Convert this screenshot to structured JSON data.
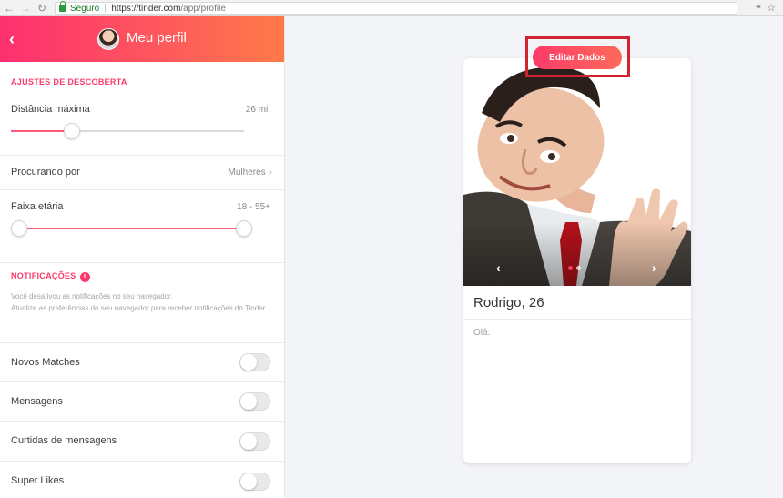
{
  "browser": {
    "secure_label": "Seguro",
    "url_host": "https://tinder.com",
    "url_path": "/app/profile"
  },
  "sidebar": {
    "title": "Meu perfil",
    "discovery_section": "AJUSTES DE DESCOBERTA",
    "max_distance": {
      "label": "Distância máxima",
      "value": "26 mi.",
      "fraction": 0.26
    },
    "looking_for": {
      "label": "Procurando por",
      "value": "Mulheres"
    },
    "age_range": {
      "label": "Faixa etária",
      "value": "18 - 55+",
      "min_fraction": 0.0,
      "max_fraction": 1.0
    },
    "notifications_section": "NOTIFICAÇÕES",
    "notice_line1": "Você desativou as notificações no seu navegador.",
    "notice_line2": "Atualize as preferências do seu navegador para receber notificações do Tinder.",
    "toggles": [
      {
        "label": "Novos Matches",
        "on": false
      },
      {
        "label": "Mensagens",
        "on": false
      },
      {
        "label": "Curtidas de mensagens",
        "on": false
      },
      {
        "label": "Super Likes",
        "on": false
      }
    ]
  },
  "main": {
    "edit_button": "Editar Dados",
    "card_name": "Rodrigo, 26",
    "card_bio": "Olá.",
    "photo_dots": 2,
    "active_dot": 0
  },
  "colors": {
    "accent": "#fd3b6a",
    "highlight": "#d0232f"
  }
}
